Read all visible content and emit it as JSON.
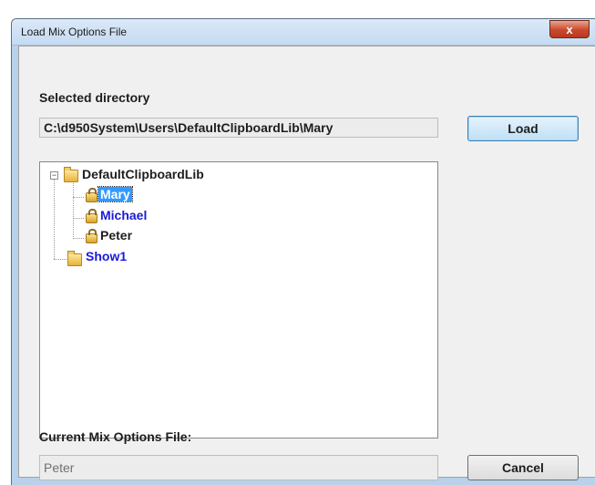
{
  "window": {
    "title": "Load Mix Options File",
    "close_label": "x"
  },
  "directory": {
    "label": "Selected directory",
    "path": "C:\\d950System\\Users\\DefaultClipboardLib\\Mary"
  },
  "buttons": {
    "load": "Load",
    "cancel": "Cancel"
  },
  "tree": {
    "root": {
      "label": "DefaultClipboardLib",
      "expander": "−",
      "icon": "folder-icon"
    },
    "children": [
      {
        "label": "Mary",
        "icon": "lock-icon",
        "selected": true
      },
      {
        "label": "Michael",
        "icon": "lock-icon",
        "color": "#1a1ad8"
      },
      {
        "label": "Peter",
        "icon": "lock-icon",
        "color": "#1e1e1e"
      }
    ],
    "sibling": {
      "label": "Show1",
      "icon": "folder-icon",
      "color": "#1a1ad8"
    }
  },
  "current_file": {
    "label": "Current Mix Options File:",
    "value": "Peter"
  }
}
